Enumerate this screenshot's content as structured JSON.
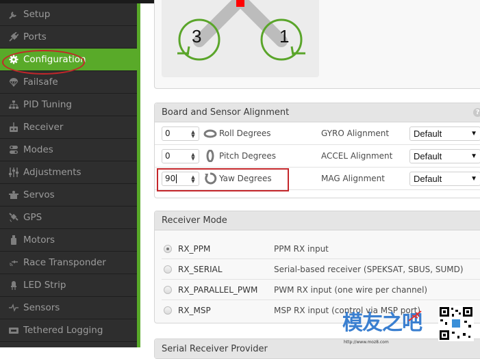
{
  "sidebar": {
    "items": [
      {
        "label": "Setup",
        "icon": "wrench-icon",
        "active": false
      },
      {
        "label": "Ports",
        "icon": "plug-icon",
        "active": false
      },
      {
        "label": "Configuration",
        "icon": "gear-icon",
        "active": true
      },
      {
        "label": "Failsafe",
        "icon": "parachute-icon",
        "active": false
      },
      {
        "label": "PID Tuning",
        "icon": "sitemap-icon",
        "active": false
      },
      {
        "label": "Receiver",
        "icon": "remote-control-icon",
        "active": false
      },
      {
        "label": "Modes",
        "icon": "toggles-icon",
        "active": false
      },
      {
        "label": "Adjustments",
        "icon": "sliders-icon",
        "active": false
      },
      {
        "label": "Servos",
        "icon": "servo-icon",
        "active": false
      },
      {
        "label": "GPS",
        "icon": "satellite-icon",
        "active": false
      },
      {
        "label": "Motors",
        "icon": "motor-icon",
        "active": false
      },
      {
        "label": "Race Transponder",
        "icon": "transponder-icon",
        "active": false
      },
      {
        "label": "LED Strip",
        "icon": "led-icon",
        "active": false
      },
      {
        "label": "Sensors",
        "icon": "pulse-icon",
        "active": false
      },
      {
        "label": "Tethered Logging",
        "icon": "logging-icon",
        "active": false
      }
    ]
  },
  "mixer": {
    "motor_left": "3",
    "motor_right": "1"
  },
  "alignment": {
    "title": "Board and Sensor Alignment",
    "help": "?",
    "rows": [
      {
        "value": "0",
        "axis_label": "Roll Degrees",
        "axis_icon": "roll-icon",
        "sensor_label": "GYRO Alignment",
        "select": "Default"
      },
      {
        "value": "0",
        "axis_label": "Pitch Degrees",
        "axis_icon": "pitch-icon",
        "sensor_label": "ACCEL Alignment",
        "select": "Default"
      },
      {
        "value": "90",
        "axis_label": "Yaw Degrees",
        "axis_icon": "yaw-icon",
        "sensor_label": "MAG Alignment",
        "select": "Default"
      }
    ]
  },
  "receiver_mode": {
    "title": "Receiver Mode",
    "options": [
      {
        "name": "RX_PPM",
        "desc": "PPM RX input",
        "checked": true
      },
      {
        "name": "RX_SERIAL",
        "desc": "Serial-based receiver (SPEKSAT, SBUS, SUMD)",
        "checked": false
      },
      {
        "name": "RX_PARALLEL_PWM",
        "desc": "PWM RX input (one wire per channel)",
        "checked": false
      },
      {
        "name": "RX_MSP",
        "desc": "MSP RX input (control via MSP port)",
        "checked": false
      }
    ]
  },
  "serial_receiver": {
    "title": "Serial Receiver Provider"
  },
  "watermark": {
    "text": "模友之吧",
    "url": "http://www.moz8.com"
  },
  "colors": {
    "accent_green": "#59aa29",
    "annotation_red": "#c4262a",
    "motor_ring": "#5aa52a"
  }
}
